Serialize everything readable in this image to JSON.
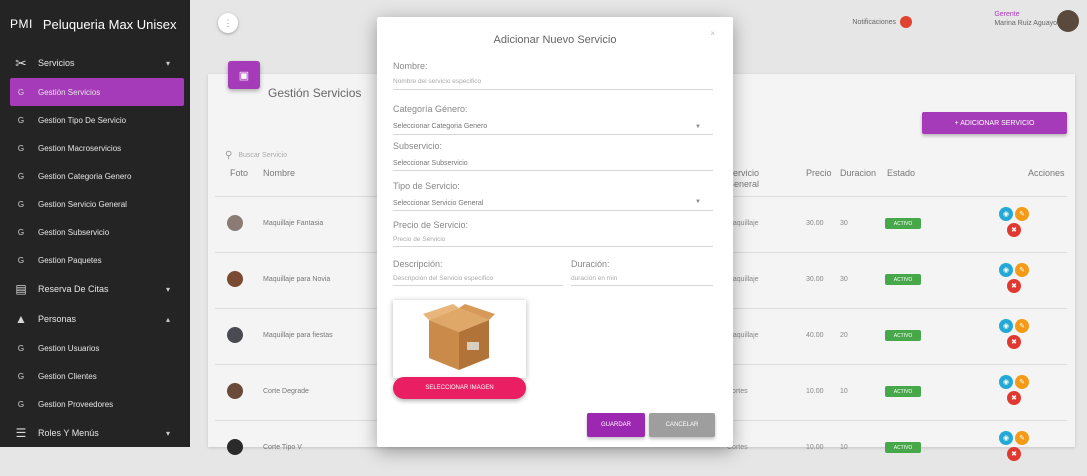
{
  "brand": {
    "abbr": "PMI",
    "name": "Peluqueria Max Unisex"
  },
  "sidebar": {
    "items": [
      {
        "icon": "scissors-icon",
        "label": "Servicios",
        "chev": "▾",
        "type": "big"
      },
      {
        "icon": "G",
        "label": "Gestión Servicios",
        "type": "active"
      },
      {
        "icon": "G",
        "label": "Gestion Tipo De Servicio",
        "type": "sub"
      },
      {
        "icon": "G",
        "label": "Gestion Macroservicios",
        "type": "sub"
      },
      {
        "icon": "G",
        "label": "Gestion Categoria Genero",
        "type": "sub"
      },
      {
        "icon": "G",
        "label": "Gestion Servicio General",
        "type": "sub"
      },
      {
        "icon": "G",
        "label": "Gestion Subservicio",
        "type": "sub"
      },
      {
        "icon": "G",
        "label": "Gestion Paquetes",
        "type": "sub"
      },
      {
        "icon": "calendar-icon",
        "label": "Reserva De Citas",
        "chev": "▾",
        "type": "big"
      },
      {
        "icon": "person-icon",
        "label": "Personas",
        "chev": "▴",
        "type": "big"
      },
      {
        "icon": "G",
        "label": "Gestion Usuarios",
        "type": "sub"
      },
      {
        "icon": "G",
        "label": "Gestion Clientes",
        "type": "sub"
      },
      {
        "icon": "G",
        "label": "Gestion Proveedores",
        "type": "sub"
      },
      {
        "icon": "menu-icon",
        "label": "Roles Y Menús",
        "chev": "▾",
        "type": "big"
      }
    ]
  },
  "topbar": {
    "notifications": "Notificaciones",
    "user_role": "Gerente",
    "user_name": "Marina Ruiz Aguayo"
  },
  "card": {
    "title": "Gestión Servicios",
    "add_button": "+ ADICIONAR SERVICIO",
    "search_placeholder": "Buscar Servicio"
  },
  "table": {
    "headers": {
      "foto": "Foto",
      "nombre": "Nombre",
      "servicio_general": "Servicio General",
      "precio": "Precio",
      "duracion": "Duracion",
      "estado": "Estado",
      "acciones": "Acciones"
    },
    "rows": [
      {
        "nombre": "Maquillaje Fantasia",
        "servicio_general": "Maquillaje",
        "precio": "30.00",
        "duracion": "30",
        "estado": "ACTIVO"
      },
      {
        "nombre": "Maquillaje para Novia",
        "servicio_general": "Maquillaje",
        "precio": "30.00",
        "duracion": "30",
        "estado": "ACTIVO"
      },
      {
        "nombre": "Maquillaje para fiestas",
        "servicio_general": "Maquillaje",
        "precio": "40.00",
        "duracion": "20",
        "estado": "ACTIVO"
      },
      {
        "nombre": "Corte Degrade",
        "servicio_general": "Cortes",
        "precio": "10.00",
        "duracion": "10",
        "estado": "ACTIVO"
      },
      {
        "nombre": "Corte Tipo V",
        "servicio_general": "Cortes",
        "precio": "10.00",
        "duracion": "10",
        "estado": "ACTIVO"
      }
    ]
  },
  "modal": {
    "title": "Adicionar Nuevo Servicio",
    "close": "×",
    "nombre_label": "Nombre:",
    "nombre_placeholder": "Nombre del servicio especifico",
    "categoria_label": "Categoría Género:",
    "categoria_value": "Seleccionar Categoria Genero",
    "subservicio_label": "Subservicio:",
    "subservicio_value": "Seleccionar Subservicio",
    "tipo_label": "Tipo de Servicio:",
    "tipo_value": "Seleccionar Servicio General",
    "precio_label": "Precio de Servicio:",
    "precio_placeholder": "Precio de Servicio",
    "descripcion_label": "Descripción:",
    "descripcion_placeholder": "Descripción del Servicio especifico",
    "duracion_label": "Duración:",
    "duracion_placeholder": "duración en min",
    "choose_image": "SELECCIONAR IMAGEN",
    "save": "GUARDAR",
    "cancel": "CANCELAR"
  },
  "colors": {
    "accent": "#a53bb9",
    "active": "#47a84a",
    "pink": "#e91e63"
  }
}
